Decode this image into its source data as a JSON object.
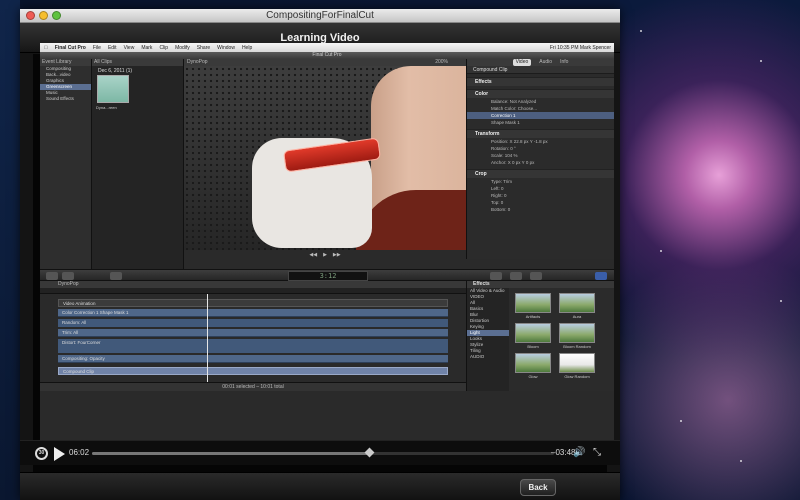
{
  "window": {
    "title": "CompositingForFinalCut"
  },
  "header": {
    "title": "Learning Video"
  },
  "screencast": {
    "menubar": {
      "app": "Final Cut Pro",
      "items": [
        "File",
        "Edit",
        "View",
        "Mark",
        "Clip",
        "Modify",
        "Share",
        "Window",
        "Help"
      ],
      "right": "Fri 10:35 PM  Mark Spencer"
    },
    "fcp_title": "Final Cut Pro",
    "library": {
      "header": "Event Library",
      "items": [
        "Compositing",
        "Back...video",
        "Graphics",
        "Greenscreen",
        "Music",
        "Sound Effects"
      ]
    },
    "clips": {
      "header": "All Clips",
      "date": "Dec 6, 2011  (1)",
      "clip_name": "Dyna...reen"
    },
    "viewer": {
      "title": "DynoPop",
      "zoom": "200%"
    },
    "inspector": {
      "tabs": [
        "Video",
        "Audio",
        "Info"
      ],
      "title": "Compound Clip",
      "sections": {
        "effects": "Effects",
        "color": "Color",
        "transform": "Transform",
        "crop": "Crop"
      },
      "color_rows": [
        "Balance:  Not Analyzed",
        "Match Color:  Choose..."
      ],
      "correction_rows": [
        "Correction 1",
        "Shape Mask 1"
      ],
      "transform_rows": [
        "Position:  X  22.8 px   Y  -1.8 px",
        "Rotation:  0 °",
        "Scale:  104 %",
        "Anchor:  X  0 px   Y  0 px"
      ],
      "crop_rows": [
        "Type:  Trim",
        "Left:  0",
        "Right:  0",
        "Top:  0",
        "Bottom:  0"
      ]
    },
    "timecode": "3:12",
    "timeline": {
      "title": "DynoPop",
      "tracks": [
        "Video Animation",
        "Color Correction 1 Shape Mask 1",
        "Random: All",
        "Trim: All",
        "Distort: FourCorner",
        "Compositing: Opacity",
        "Compound Clip"
      ],
      "status": "00:01 selected – 10:01 total"
    },
    "effects_browser": {
      "title": "Effects",
      "categories": [
        "All Video & Audio",
        "VIDEO",
        "All",
        "Basics",
        "Blur",
        "Distortion",
        "Keying",
        "Light",
        "Looks",
        "Stylize",
        "Tiling",
        "AUDIO"
      ],
      "selected_category": "Light",
      "effects": [
        "Artifacts",
        "Aura",
        "Bloom",
        "Bloom Random",
        "Glow",
        "Glow Random"
      ]
    }
  },
  "player": {
    "replay_label": "30",
    "elapsed": "06:02",
    "remaining": "–03:48",
    "progress": 0.6
  },
  "footer": {
    "back_label": "Back"
  }
}
